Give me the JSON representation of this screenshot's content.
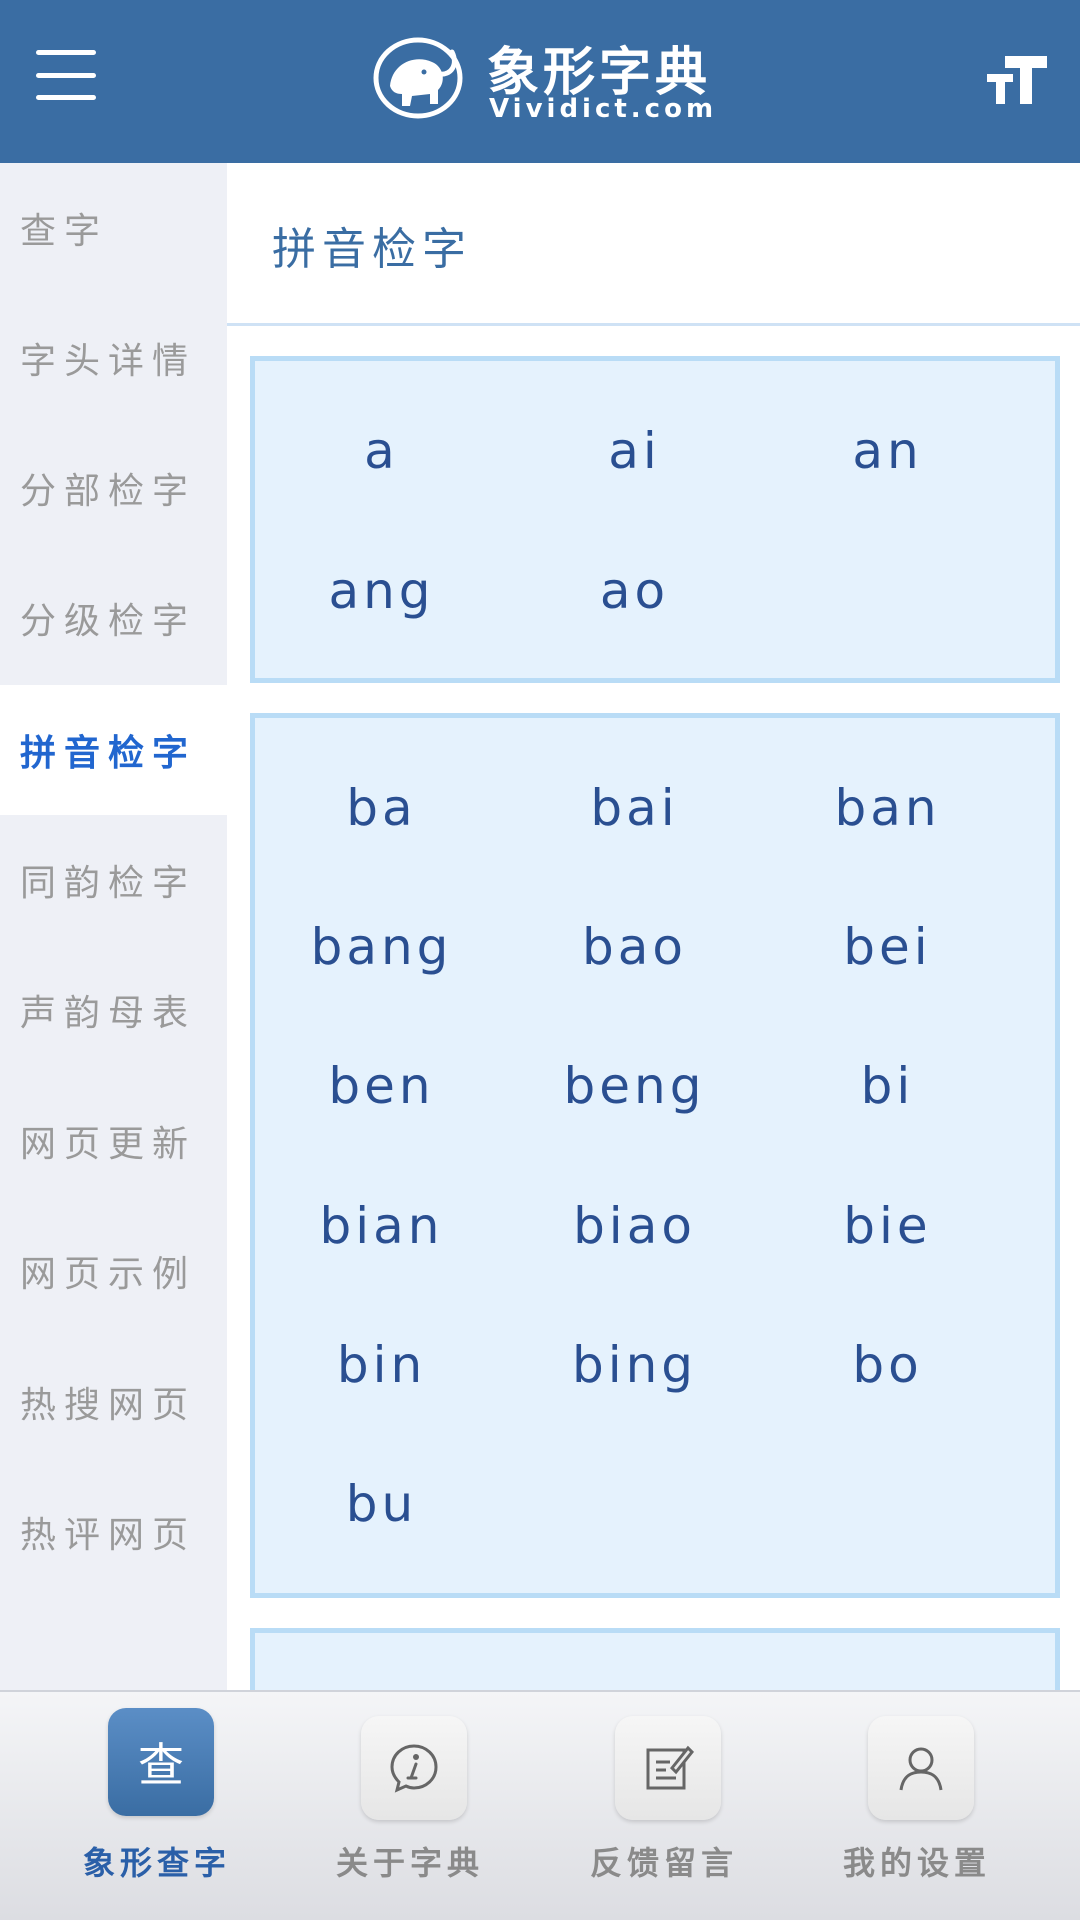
{
  "header": {
    "logo_cn": "象形字典",
    "logo_en": "Vividict.com",
    "menu_icon": "hamburger-menu-icon",
    "font_icon": "font-size-icon"
  },
  "sidebar": {
    "items": [
      {
        "label": "查字"
      },
      {
        "label": "字头详情"
      },
      {
        "label": "分部检字"
      },
      {
        "label": "分级检字"
      },
      {
        "label": "拼音检字",
        "active": true
      },
      {
        "label": "同韵检字"
      },
      {
        "label": "声韵母表"
      },
      {
        "label": "网页更新"
      },
      {
        "label": "网页示例"
      },
      {
        "label": "热搜网页"
      },
      {
        "label": "热评网页"
      }
    ]
  },
  "main": {
    "title": "拼音检字",
    "groups": [
      {
        "items": [
          "a",
          "ai",
          "an",
          "ang",
          "ao"
        ]
      },
      {
        "items": [
          "ba",
          "bai",
          "ban",
          "bang",
          "bao",
          "bei",
          "ben",
          "beng",
          "bi",
          "bian",
          "biao",
          "bie",
          "bin",
          "bing",
          "bo",
          "bu"
        ]
      }
    ]
  },
  "bottom_nav": {
    "items": [
      {
        "label": "象形查字",
        "glyph": "查",
        "icon": "search-char-icon",
        "active": true
      },
      {
        "label": "关于字典",
        "icon": "info-chat-icon"
      },
      {
        "label": "反馈留言",
        "icon": "edit-note-icon"
      },
      {
        "label": "我的设置",
        "icon": "user-profile-icon"
      }
    ]
  },
  "colors": {
    "header_bg": "#3a6da3",
    "sidebar_bg": "#eef0f6",
    "active_text": "#2166cf",
    "group_bg": "#e5f2fd",
    "group_border": "#b9dcf6",
    "pinyin_text": "#2a4f91"
  }
}
